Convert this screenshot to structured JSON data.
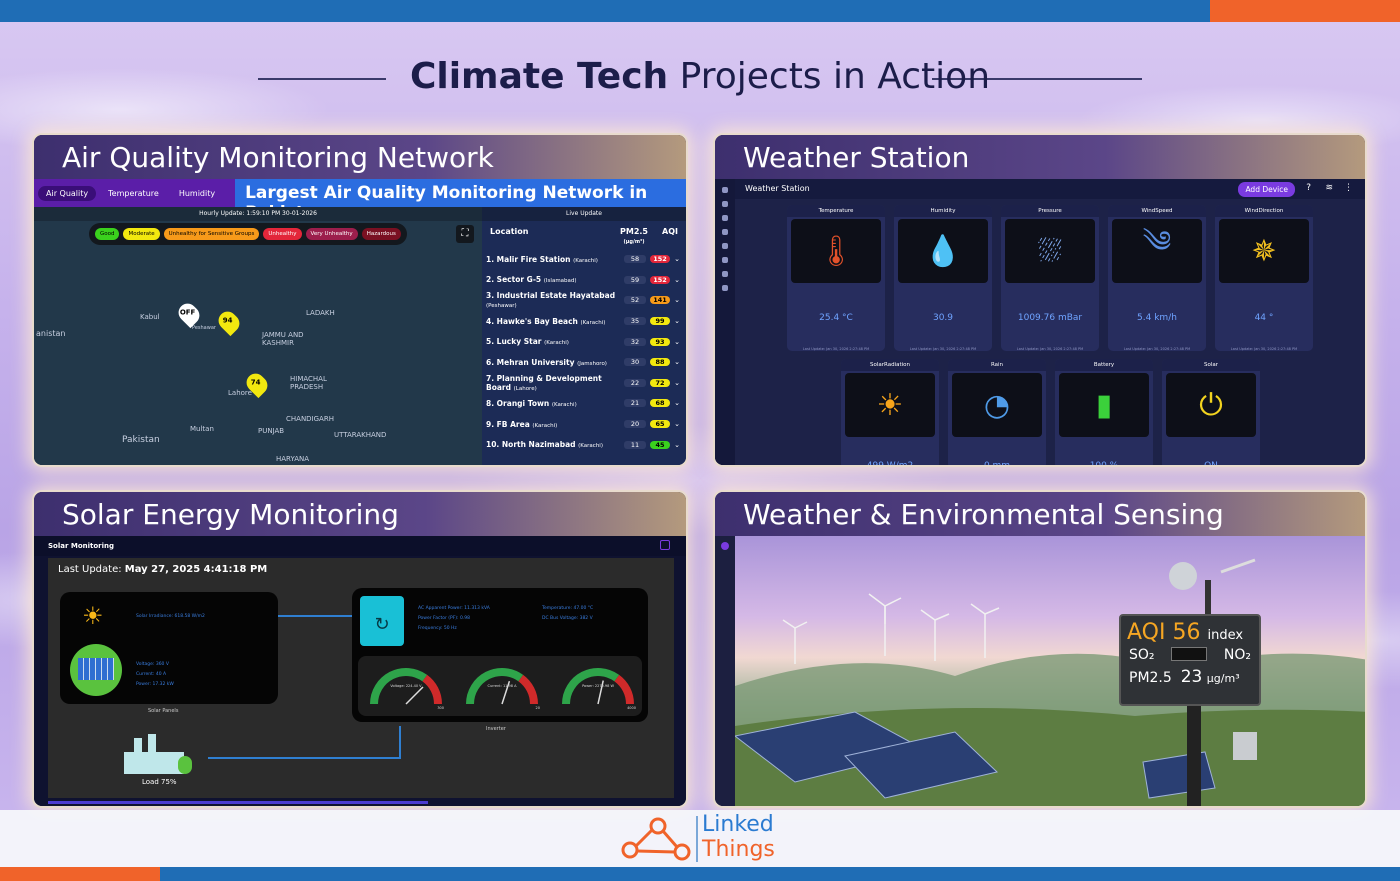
{
  "headline": {
    "bold": "Climate Tech",
    "rest": "Projects in Action"
  },
  "panels": {
    "air_quality": {
      "title": "Air Quality Monitoring Network",
      "tabs": [
        "Air Quality",
        "Temperature",
        "Humidity"
      ],
      "banner": "Largest Air Quality Monitoring Network in Pakistan",
      "hourly_update": "Hourly Update: 1:59:10 PM 30-01-2026",
      "live_update": "Live Update",
      "legend": [
        {
          "label": "Good",
          "color": "#3ad11d"
        },
        {
          "label": "Moderate",
          "color": "#f2e80f"
        },
        {
          "label": "Unhealthy for Sensitive Groups",
          "color": "#f79a1a"
        },
        {
          "label": "Unhealthy",
          "color": "#e3263a"
        },
        {
          "label": "Very Unhealthy",
          "color": "#9c1e4c"
        },
        {
          "label": "Hazardous",
          "color": "#7a1022"
        }
      ],
      "map_labels": [
        "Kabul",
        "Peshawar",
        "Lahore",
        "Multan",
        "Pakistan",
        "LADAKH",
        "JAMMU AND KASHMIR",
        "HIMACHAL PRADESH",
        "PUNJAB",
        "CHANDIGARH",
        "UTTARAKHAND",
        "HARYANA",
        "anistan"
      ],
      "pins": [
        {
          "label": "OFF",
          "color": "#ffffff"
        },
        {
          "label": "94",
          "color": "#f2e80f"
        },
        {
          "label": "74",
          "color": "#f2e80f"
        }
      ],
      "list_headers": {
        "location": "Location",
        "pm": "PM2.5",
        "pm_unit": "(µg/m³)",
        "aqi": "AQI"
      },
      "rows": [
        {
          "name": "1. Malir Fire Station",
          "city": "(Karachi)",
          "pm": "58",
          "aqi": "152",
          "color": "#e3263a"
        },
        {
          "name": "2. Sector G-5",
          "city": "(Islamabad)",
          "pm": "59",
          "aqi": "152",
          "color": "#e3263a"
        },
        {
          "name": "3. Industrial Estate Hayatabad",
          "city": "(Peshawar)",
          "pm": "52",
          "aqi": "141",
          "color": "#f79a1a"
        },
        {
          "name": "4. Hawke's Bay Beach",
          "city": "(Karachi)",
          "pm": "35",
          "aqi": "99",
          "color": "#f2e80f"
        },
        {
          "name": "5. Lucky Star",
          "city": "(Karachi)",
          "pm": "32",
          "aqi": "93",
          "color": "#f2e80f"
        },
        {
          "name": "6. Mehran University",
          "city": "(Jamshoro)",
          "pm": "30",
          "aqi": "88",
          "color": "#f2e80f"
        },
        {
          "name": "7. Planning & Development Board",
          "city": "(Lahore)",
          "pm": "22",
          "aqi": "72",
          "color": "#f2e80f"
        },
        {
          "name": "8. Orangi Town",
          "city": "(Karachi)",
          "pm": "21",
          "aqi": "68",
          "color": "#f2e80f"
        },
        {
          "name": "9. FB Area",
          "city": "(Karachi)",
          "pm": "20",
          "aqi": "65",
          "color": "#f2e80f"
        },
        {
          "name": "10. North Nazimabad",
          "city": "(Karachi)",
          "pm": "11",
          "aqi": "45",
          "color": "#3ad11d"
        }
      ]
    },
    "weather_station": {
      "title": "Weather Station",
      "app_title": "Weather Station",
      "add_device": "Add Device",
      "cards_top": [
        {
          "name": "Temperature",
          "value": "25.4 °C",
          "icon": "thermometer-icon",
          "glyph": "🌡"
        },
        {
          "name": "Humidity",
          "value": "30.9",
          "icon": "droplet-icon",
          "glyph": "💧"
        },
        {
          "name": "Pressure",
          "value": "1009.76 mBar",
          "icon": "pressure-icon",
          "glyph": "⛆"
        },
        {
          "name": "WindSpeed",
          "value": "5.4 km/h",
          "icon": "wind-icon",
          "glyph": "༄"
        },
        {
          "name": "WindDirection",
          "value": "44 °",
          "icon": "compass-icon",
          "glyph": "✵"
        }
      ],
      "cards_bottom": [
        {
          "name": "SolarRadiation",
          "value": "499 W/m2",
          "icon": "sun-icon",
          "glyph": "☀"
        },
        {
          "name": "Rain",
          "value": "0 mm",
          "icon": "rain-gauge-icon",
          "glyph": "◔"
        },
        {
          "name": "Battery",
          "value": "100 %",
          "icon": "battery-icon",
          "glyph": "▮"
        },
        {
          "name": "Solar",
          "value": "ON",
          "icon": "power-icon",
          "glyph": "⏻"
        }
      ],
      "last_update": "Last Update: Jan 30, 2026 2:27:48 PM"
    },
    "solar": {
      "title": "Solar Energy Monitoring",
      "app_title": "Solar Monitoring",
      "last_update_label": "Last Update:",
      "last_update_value": "May 27, 2025 4:41:18 PM",
      "panel_irradiance": "Solar Irradiance: 618.58 W/m2",
      "panel_voltage": "Voltage: 360 V",
      "panel_current": "Current: 40 A",
      "panel_power": "Power: 17.32 kW",
      "panel_caption": "Solar Panels",
      "inverter_apparent": "AC Apparent Power: 11.313 kVA",
      "inverter_pf": "Power Factor (PF): 0.98",
      "inverter_freq": "Frequency: 50 Hz",
      "inverter_temp": "Temperature: 47.00 °C",
      "inverter_dc": "DC Bus Voltage: 382 V",
      "inverter_caption": "Inverter",
      "gauges": [
        {
          "label": "Voltage: 224.40 V",
          "max": "300",
          "fraction": 0.75
        },
        {
          "label": "Current: 11.98 A",
          "max": "20",
          "fraction": 0.6
        },
        {
          "label": "Power: 2270.98 W",
          "max": "4000",
          "fraction": 0.57
        }
      ],
      "load": "Load 75%"
    },
    "environment": {
      "title": "Weather & Environmental Sensing",
      "aqi_label": "AQI",
      "aqi_value": "56",
      "aqi_unit": "index",
      "so2": "SO₂",
      "no2": "NO₂",
      "pm_label": "PM2.5",
      "pm_value": "23",
      "pm_unit": "µg/m³"
    }
  },
  "brand": {
    "line1": "Linked",
    "line2": "Things"
  }
}
